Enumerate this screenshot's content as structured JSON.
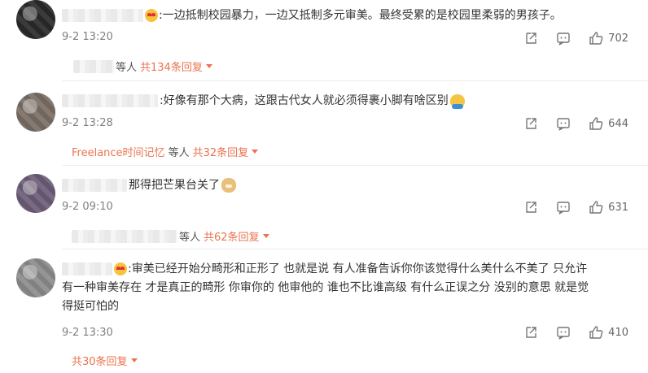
{
  "comments": [
    {
      "text": ":一边抵制校园暴力，一边又抵制多元审美。最终受累的是校园里柔弱的男孩子。",
      "time": "9-2 13:20",
      "likes": "702",
      "reply_suffix": "等人",
      "reply_count": "共134条回复",
      "avatar_color": "#2a2a2a"
    },
    {
      "text": ":好像有那个大病，这跟古代女人就必须得裹小脚有啥区别",
      "time": "9-2 13:28",
      "likes": "644",
      "reply_name": "Freelance时间记忆",
      "reply_suffix": "等人",
      "reply_count": "共32条回复",
      "avatar_color": "#7a6f66"
    },
    {
      "text": "那得把芒果台关了",
      "time": "9-2 09:10",
      "likes": "631",
      "reply_suffix": "等人",
      "reply_count": "共62条回复",
      "avatar_color": "#6d5d78"
    },
    {
      "text_lines": [
        ":审美已经开始分畸形和正形了 也就是说 有人准备告诉你你该觉得什么美什么不美了 只允许",
        "有一种审美存在 才是真正的畸形 你审你的 他审他的 谁也不比谁高级 有什么正误之分 没别的意思 就是觉",
        "得挺可怕的"
      ],
      "time": "9-2 13:30",
      "likes": "410",
      "reply_count": "共30条回复",
      "avatar_color": "#8c8c8c"
    }
  ],
  "icons": {
    "share": "share-icon",
    "comment": "comment-icon",
    "like": "thumbs-up-icon"
  },
  "colors": {
    "accent": "#eb7350",
    "meta": "#808080"
  }
}
